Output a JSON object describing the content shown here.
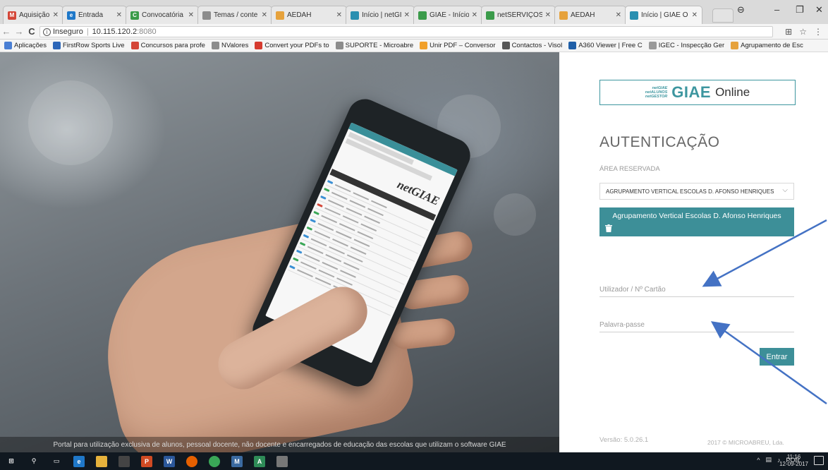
{
  "browser": {
    "tabs": [
      {
        "label": "Aquisição de",
        "color": "#d44638",
        "glyph": "M"
      },
      {
        "label": "Entrada",
        "color": "#1f78c9",
        "glyph": "e"
      },
      {
        "label": "Convocatória",
        "color": "#3b9b4a",
        "glyph": "C"
      },
      {
        "label": "Temas / conte",
        "color": "#8c8c8c",
        "glyph": ""
      },
      {
        "label": "AEDAH",
        "color": "#e6a23c",
        "glyph": ""
      },
      {
        "label": "Início | netGI",
        "color": "#2a8fb0",
        "glyph": ""
      },
      {
        "label": "GIAE - Início",
        "color": "#3b9b4a",
        "glyph": ""
      },
      {
        "label": "netSERVIÇOS",
        "color": "#3b9b4a",
        "glyph": ""
      },
      {
        "label": "AEDAH",
        "color": "#e6a23c",
        "glyph": ""
      },
      {
        "label": "Início | GIAE O",
        "color": "#2a8fb0",
        "glyph": "",
        "active": true
      }
    ],
    "address": {
      "security_label": "Inseguro",
      "host": "10.115.120.2",
      "port": ":8080"
    },
    "bookmarks": [
      {
        "label": "Aplicações",
        "color": "#4a7fd4"
      },
      {
        "label": "FirstRow Sports Live",
        "color": "#2c66b8"
      },
      {
        "label": "Concursos para profe",
        "color": "#d44638"
      },
      {
        "label": "NValores",
        "color": "#8c8c8c"
      },
      {
        "label": "Convert your PDFs to",
        "color": "#d63b2f"
      },
      {
        "label": "SUPORTE - Microabre",
        "color": "#8c8c8c"
      },
      {
        "label": "Unir PDF – Conversor",
        "color": "#f1a02b"
      },
      {
        "label": "Contactos - Visol",
        "color": "#555555"
      },
      {
        "label": "A360 Viewer | Free C",
        "color": "#1f5fa8"
      },
      {
        "label": "IGEC - Inspecção Ger",
        "color": "#999999"
      },
      {
        "label": "Agrupamento de Esc",
        "color": "#e6a23c"
      }
    ]
  },
  "hero": {
    "phone_brand": "netGIAE",
    "footer_text": "Portal para utilização exclusiva de alunos, pessoal docente, não docente e encarregados de educação das escolas que utilizam o software GIAE"
  },
  "login": {
    "logo": {
      "stack": [
        "netGIAE",
        "netALUNOS",
        "netGESTOR"
      ],
      "brand": "GIAE",
      "suffix": "Online"
    },
    "title": "AUTENTICAÇÃO",
    "area_label": "ÁREA RESERVADA",
    "school_select": "AGRUPAMENTO VERTICAL ESCOLAS D. AFONSO HENRIQUES",
    "school_card": "Agrupamento Vertical Escolas D. Afonso Henriques",
    "username_placeholder": "Utilizador / Nº Cartão",
    "password_placeholder": "Palavra-passe",
    "submit_label": "Entrar",
    "version": "Versão: 5.0.26.1",
    "copyright": "2017 © MICROABREU, Lda."
  },
  "taskbar": {
    "language": "POR",
    "time": "11:16",
    "date": "12-09-2017"
  },
  "colors": {
    "accent": "#3d8f98",
    "arrow": "#4472c4"
  }
}
